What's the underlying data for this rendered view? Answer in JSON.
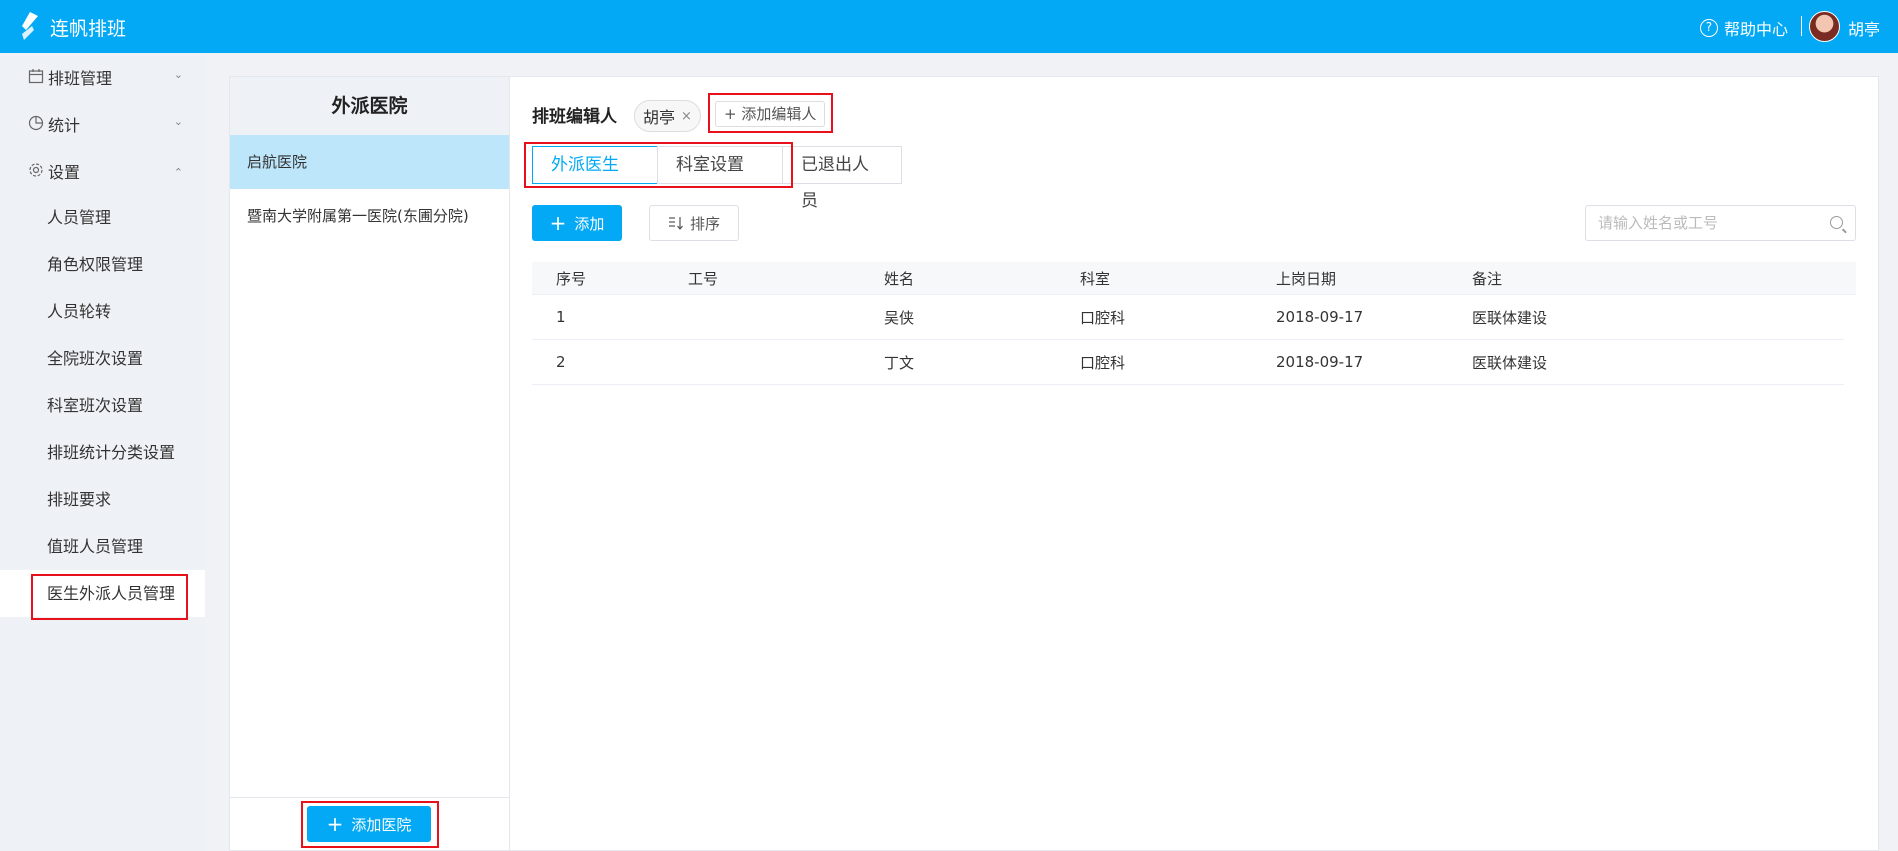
{
  "app": {
    "brand": "连帆排班"
  },
  "topbar": {
    "help_label": "帮助中心",
    "username": "胡亭"
  },
  "sidebar": {
    "menus": [
      {
        "label": "排班管理",
        "icon": "calendar-icon"
      },
      {
        "label": "统计",
        "icon": "pie-chart-icon"
      },
      {
        "label": "设置",
        "icon": "gear-icon"
      }
    ],
    "settings_items": [
      "人员管理",
      "角色权限管理",
      "人员轮转",
      "全院班次设置",
      "科室班次设置",
      "排班统计分类设置",
      "排班要求",
      "值班人员管理",
      "医生外派人员管理"
    ],
    "active_item": "医生外派人员管理"
  },
  "hospitals": {
    "title": "外派医院",
    "items": [
      "启航医院",
      "暨南大学附属第一医院(东圃分院)"
    ],
    "active": "启航医院",
    "add_button": "添加医院"
  },
  "editor": {
    "label": "排班编辑人",
    "tags": [
      "胡亭"
    ],
    "add_label": "+ 添加编辑人"
  },
  "tabs": [
    "外派医生",
    "科室设置",
    "已退出人员"
  ],
  "active_tab": "外派医生",
  "toolbar": {
    "add_label": "添加",
    "sort_label": "排序",
    "search_placeholder": "请输入姓名或工号"
  },
  "table": {
    "columns": [
      "序号",
      "工号",
      "姓名",
      "科室",
      "上岗日期",
      "备注"
    ],
    "rows": [
      [
        "1",
        "",
        "吴侠",
        "口腔科",
        "2018-09-17",
        "医联体建设"
      ],
      [
        "2",
        "",
        "丁文",
        "口腔科",
        "2018-09-17",
        "医联体建设"
      ]
    ]
  },
  "colors": {
    "primary": "#03a9f4",
    "highlight_border": "#e8101b",
    "selected_row": "#bde6fb"
  }
}
